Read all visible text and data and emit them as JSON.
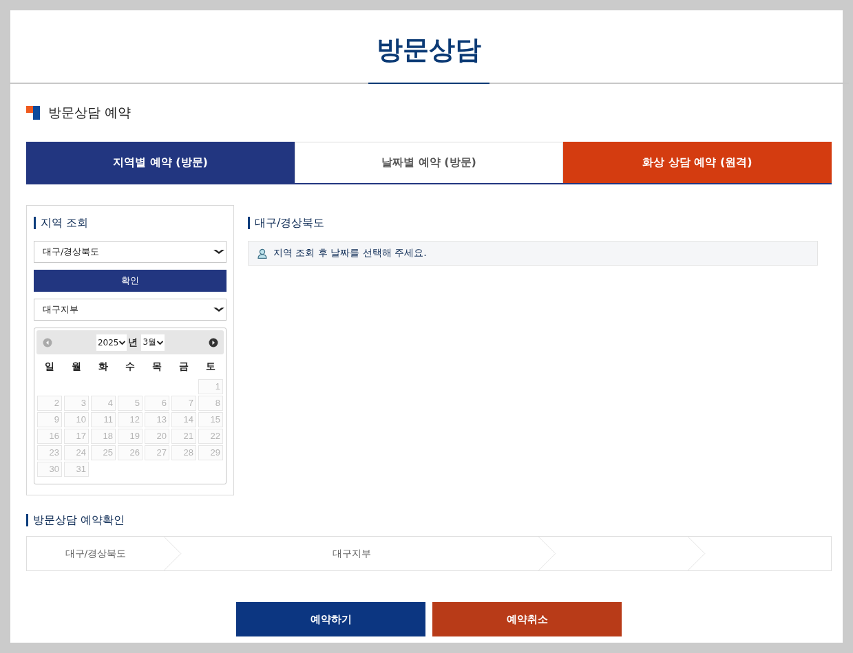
{
  "page_title": "방문상담",
  "section_title": "방문상담 예약",
  "tabs": [
    {
      "label": "지역별 예약 (방문)",
      "selected": true,
      "kind": "primary"
    },
    {
      "label": "날짜별 예약 (방문)",
      "selected": false,
      "kind": "primary"
    },
    {
      "label": "화상 상담 예약 (원격)",
      "selected": false,
      "kind": "accent"
    }
  ],
  "region_panel": {
    "title": "지역 조회",
    "region_select": "대구/경상북도",
    "confirm_button": "확인",
    "branch_select": "대구지부",
    "calendar": {
      "year": "2025",
      "year_suffix": "년",
      "month": "3월",
      "prev_disabled": true,
      "next_disabled": false,
      "weekdays": [
        "일",
        "월",
        "화",
        "수",
        "목",
        "금",
        "토"
      ],
      "weeks": [
        {
          "kind": "lead",
          "days": [
            {
              "day": "1",
              "disabled": true
            }
          ]
        },
        {
          "kind": "full",
          "days": [
            {
              "day": "2",
              "disabled": true
            },
            {
              "day": "3",
              "disabled": true
            },
            {
              "day": "4",
              "disabled": true
            },
            {
              "day": "5",
              "disabled": true
            },
            {
              "day": "6",
              "disabled": true
            },
            {
              "day": "7",
              "disabled": true
            },
            {
              "day": "8",
              "disabled": true
            }
          ]
        },
        {
          "kind": "full",
          "days": [
            {
              "day": "9",
              "disabled": true
            },
            {
              "day": "10",
              "disabled": true
            },
            {
              "day": "11",
              "disabled": true
            },
            {
              "day": "12",
              "disabled": true
            },
            {
              "day": "13",
              "disabled": true
            },
            {
              "day": "14",
              "disabled": true
            },
            {
              "day": "15",
              "disabled": true
            }
          ]
        },
        {
          "kind": "full",
          "days": [
            {
              "day": "16",
              "disabled": true
            },
            {
              "day": "17",
              "disabled": true
            },
            {
              "day": "18",
              "disabled": true
            },
            {
              "day": "19",
              "disabled": true
            },
            {
              "day": "20",
              "disabled": true
            },
            {
              "day": "21",
              "disabled": true
            },
            {
              "day": "22",
              "disabled": true
            }
          ]
        },
        {
          "kind": "full",
          "days": [
            {
              "day": "23",
              "disabled": true
            },
            {
              "day": "24",
              "disabled": true
            },
            {
              "day": "25",
              "disabled": true
            },
            {
              "day": "26",
              "disabled": true
            },
            {
              "day": "27",
              "disabled": true
            },
            {
              "day": "28",
              "disabled": true
            },
            {
              "day": "29",
              "disabled": true
            }
          ]
        },
        {
          "kind": "trail",
          "days": [
            {
              "day": "30",
              "disabled": true
            },
            {
              "day": "31",
              "disabled": true
            }
          ]
        }
      ]
    }
  },
  "result_panel": {
    "title": "대구/경상북도",
    "notice": "지역 조회 후 날짜를 선택해 주세요."
  },
  "confirmation": {
    "title": "방문상담 예약확인",
    "steps": [
      {
        "kind": "filled",
        "text": "대구/경상북도"
      },
      {
        "kind": "filled",
        "text": "대구지부"
      },
      {
        "kind": "empty"
      },
      {
        "kind": "empty"
      }
    ]
  },
  "buttons": [
    {
      "label": "예약하기",
      "kind": "primary"
    },
    {
      "label": "예약취소",
      "kind": "danger"
    }
  ]
}
